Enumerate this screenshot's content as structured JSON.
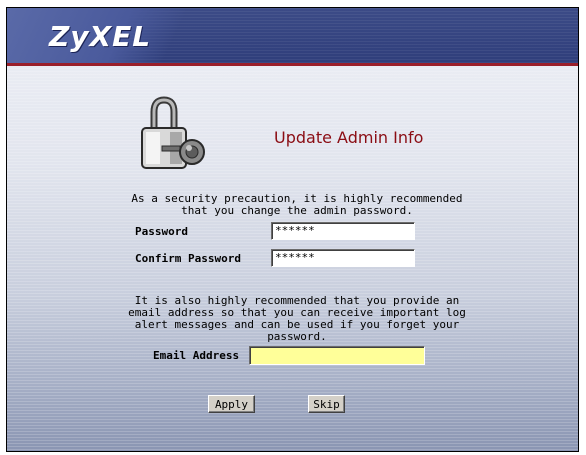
{
  "header": {
    "logo_text": "ZyXEL"
  },
  "icons": {
    "lock": "lock-key-icon"
  },
  "colors": {
    "header": "#2f3e7b",
    "accent_line": "#9a1f2a",
    "title": "#8b0d14",
    "email_field": "#ffff99"
  },
  "page": {
    "title": "Update Admin Info",
    "intro_line1": "As a security precaution, it is highly recommended",
    "intro_line2": "that you change the admin password.",
    "email_note_line1": "It is also highly recommended that you provide an",
    "email_note_line2": "email address so that you can receive important log",
    "email_note_line3": "alert messages and can be used if you forget your",
    "email_note_line4": "password."
  },
  "form": {
    "password_label": "Password",
    "password_value": "******",
    "confirm_label": "Confirm Password",
    "confirm_value": "******",
    "email_label": "Email Address",
    "email_value": ""
  },
  "buttons": {
    "apply": "Apply",
    "skip": "Skip"
  }
}
